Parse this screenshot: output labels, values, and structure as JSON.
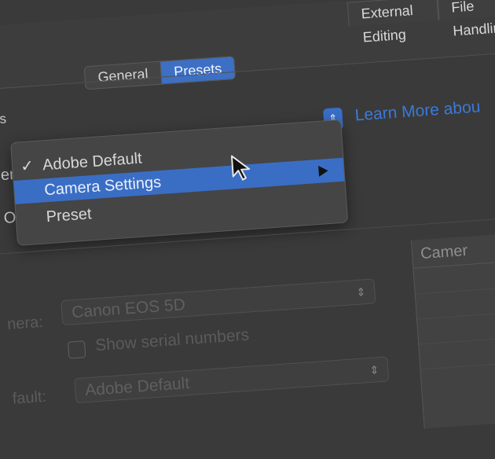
{
  "top_tabs": [
    "External Editing",
    "File Handling"
  ],
  "segments": [
    {
      "label": "General",
      "active": false
    },
    {
      "label": "Presets",
      "active": true
    }
  ],
  "fragments": {
    "defaults_heading": "lts",
    "master_label": "er",
    "override_label": "Ov",
    "camera_label": "nera:",
    "default_label": "fault:"
  },
  "learn_more": "Learn More abou",
  "menu": {
    "items": [
      {
        "label": "Adobe Default",
        "checked": true,
        "checkmark": "✓",
        "highlighted": false,
        "submenu": false
      },
      {
        "label": "Camera Settings",
        "checked": false,
        "checkmark": "",
        "highlighted": true,
        "submenu": true
      },
      {
        "label": "Preset",
        "checked": false,
        "checkmark": "",
        "highlighted": false,
        "submenu": false
      }
    ]
  },
  "camera_select": {
    "value": "Canon EOS 5D"
  },
  "serial_checkbox": {
    "label": "Show serial numbers",
    "checked": false
  },
  "default_select": {
    "value": "Adobe Default"
  },
  "table": {
    "header": "Camer"
  },
  "colors": {
    "accent": "#3a6ec5",
    "link": "#3b79d8"
  }
}
